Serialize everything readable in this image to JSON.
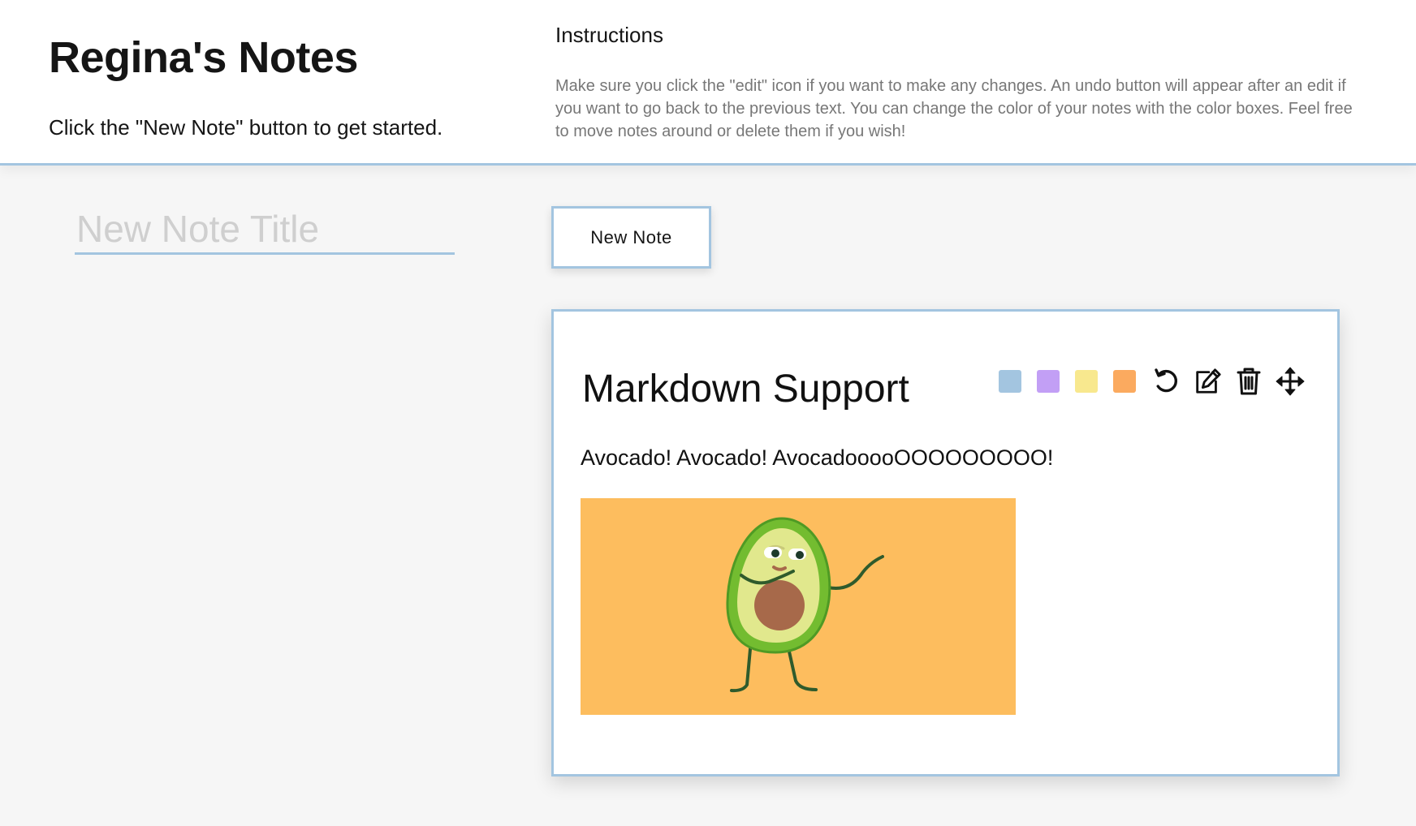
{
  "header": {
    "title": "Regina's Notes",
    "subtitle": "Click the \"New Note\" button to get started.",
    "instructions_heading": "Instructions",
    "instructions_body": "Make sure you click the \"edit\" icon if you want to make any changes. An undo button will appear after an edit if you want to go back to the previous text. You can change the color of your notes with the color boxes. Feel free to move notes around or delete them if you wish!"
  },
  "title_input": {
    "placeholder": "New Note Title",
    "value": ""
  },
  "new_note_button": {
    "label": "New Note"
  },
  "note": {
    "title": "Markdown Support",
    "text": "Avocado! Avocado! AvocadooooOOOOOOOOO!",
    "image_description": "dancing avocado",
    "color_swatches": [
      {
        "name": "blue",
        "color": "#a3c5e0"
      },
      {
        "name": "purple",
        "color": "#c29ff5"
      },
      {
        "name": "yellow",
        "color": "#f8e88e"
      },
      {
        "name": "orange",
        "color": "#fbaa5f"
      }
    ],
    "tools": [
      "undo-icon",
      "edit-icon",
      "trash-icon",
      "move-icon"
    ]
  },
  "colors": {
    "accent": "#a3c5e0",
    "page_background": "#f6f6f6",
    "image_background": "#fdbd5e",
    "instruction_text": "#777777"
  }
}
